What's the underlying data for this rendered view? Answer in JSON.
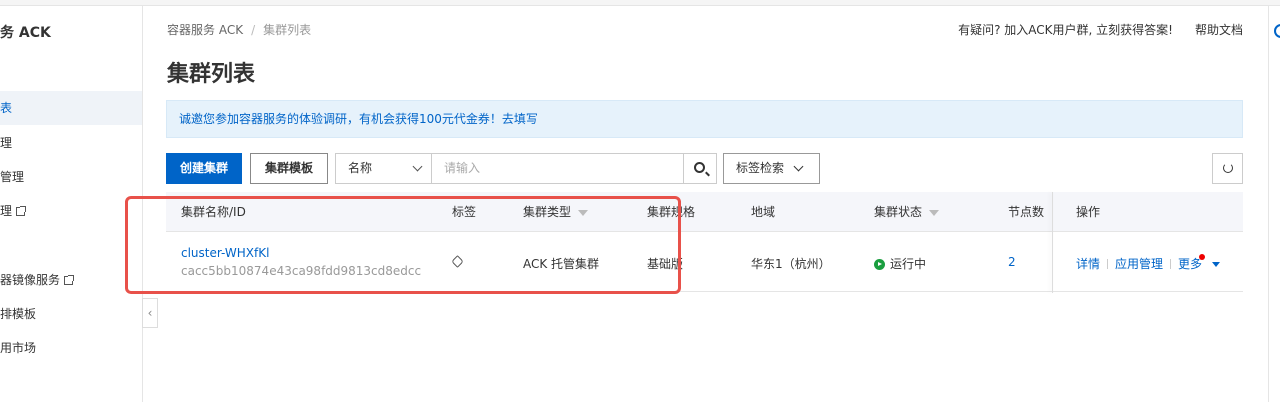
{
  "sidebar": {
    "title": "务 ACK",
    "items": [
      {
        "label": "表",
        "active": true
      },
      {
        "label": "理",
        "active": false
      },
      {
        "label": "管理",
        "active": false
      },
      {
        "label": "理",
        "active": false,
        "external": true
      },
      {
        "label": "器镜像服务",
        "active": false,
        "external": true
      },
      {
        "label": "排模板",
        "active": false
      },
      {
        "label": "用市场",
        "active": false
      }
    ]
  },
  "breadcrumb": [
    "容器服务 ACK",
    "集群列表"
  ],
  "top_links": [
    "有疑问? 加入ACK用户群, 立刻获得答案!",
    "帮助文档"
  ],
  "page_title": "集群列表",
  "notice": "诚邀您参加容器服务的体验调研，有机会获得100元代金券！去填写",
  "toolbar": {
    "create_label": "创建集群",
    "template_label": "集群模板",
    "search_field": "名称",
    "search_placeholder": "请输入",
    "tag_search_label": "标签检索"
  },
  "table": {
    "columns": [
      "集群名称/ID",
      "标签",
      "集群类型",
      "集群规格",
      "地域",
      "集群状态",
      "节点数",
      "操作"
    ],
    "rows": [
      {
        "name": "cluster-WHXfKl",
        "id": "cacc5bb10874e43ca98fdd9813cd8edcc",
        "type": "ACK 托管集群",
        "spec": "基础版",
        "region": "华东1（杭州）",
        "status": "运行中",
        "nodes": "2",
        "actions": [
          "详情",
          "应用管理",
          "更多"
        ]
      }
    ]
  },
  "colors": {
    "accent": "#0064c8",
    "status_running": "#1a9e3f",
    "highlight": "#e8514a",
    "notice_bg": "#e6f2fb"
  }
}
